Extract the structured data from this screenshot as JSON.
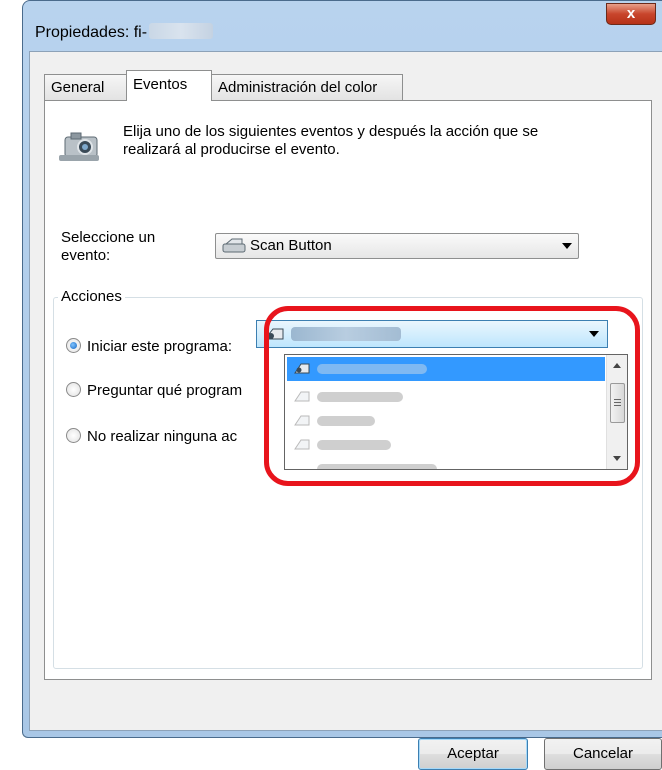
{
  "window": {
    "title": "Propiedades: fi-",
    "close_label": "x"
  },
  "tabs": [
    {
      "label": "General"
    },
    {
      "label": "Eventos"
    },
    {
      "label": "Administración del color"
    }
  ],
  "events": {
    "description": "Elija uno de los siguientes eventos y después la acción que se realizará al producirse el evento.",
    "select_label": "Seleccione un evento:",
    "selected_event": "Scan Button",
    "camera_icon": "camera-icon",
    "scanner_icon": "scanner-icon"
  },
  "actions": {
    "group_title": "Acciones",
    "option_start": "Iniciar este programa:",
    "option_ask": "Preguntar qué program",
    "option_none": "No realizar ninguna ac",
    "selected_option": "start"
  },
  "buttons": {
    "ok": "Aceptar",
    "cancel": "Cancelar"
  },
  "colors": {
    "highlight": "#e8141c",
    "selection": "#3399ff"
  }
}
